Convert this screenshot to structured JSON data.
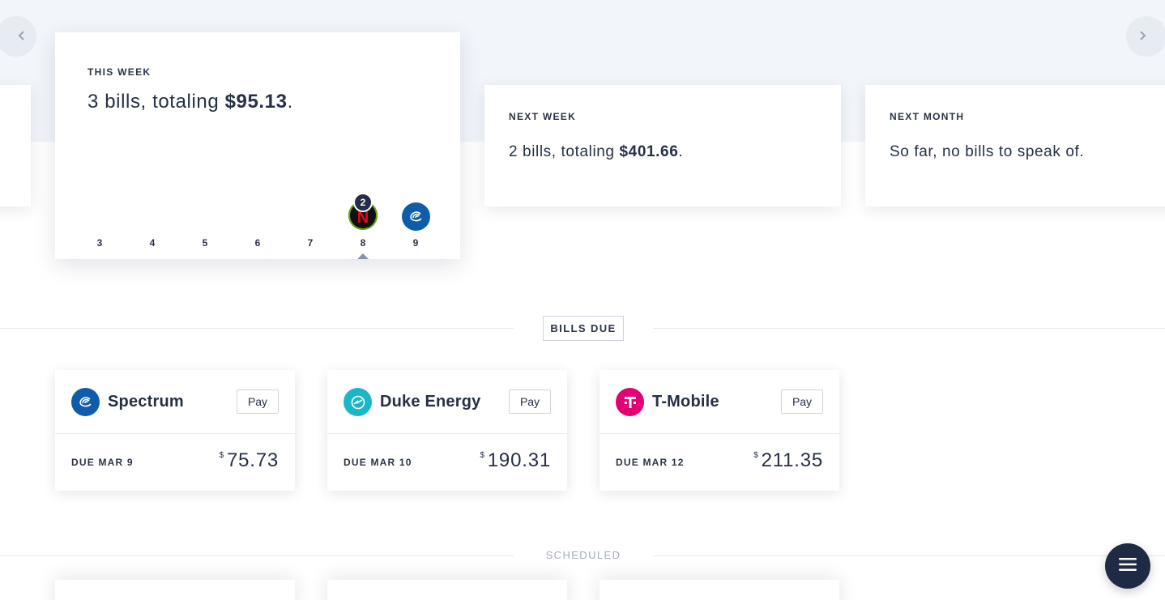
{
  "carousel": {
    "this_week": {
      "label": "THIS WEEK",
      "summary_prefix": "3 bills, totaling ",
      "summary_total": "$95.13",
      "summary_suffix": ".",
      "days": [
        "3",
        "4",
        "5",
        "6",
        "7",
        "8",
        "9"
      ],
      "selected_day": "8",
      "day8_bill_count": "2",
      "day8_icon": "netflix-logo-icon",
      "day9_icon": "spectrum-logo-icon"
    },
    "next_week": {
      "label": "NEXT WEEK",
      "summary_prefix": "2 bills, totaling ",
      "summary_total": "$401.66",
      "summary_suffix": "."
    },
    "next_month": {
      "label": "NEXT MONTH",
      "summary": "So far, no bills to speak of."
    }
  },
  "sections": {
    "bills_due": "BILLS DUE",
    "scheduled": "SCHEDULED"
  },
  "bills": [
    {
      "name": "Spectrum",
      "pay_label": "Pay",
      "due": "DUE MAR 9",
      "currency": "$",
      "amount": "75.73",
      "color": "#0d5dab",
      "icon": "spectrum-logo-icon"
    },
    {
      "name": "Duke Energy",
      "pay_label": "Pay",
      "due": "DUE MAR 10",
      "currency": "$",
      "amount": "190.31",
      "color": "#1bb7c9",
      "icon": "duke-energy-logo-icon"
    },
    {
      "name": "T-Mobile",
      "pay_label": "Pay",
      "due": "DUE MAR 12",
      "currency": "$",
      "amount": "211.35",
      "color": "#e20074",
      "icon": "t-mobile-logo-icon"
    }
  ],
  "colors": {
    "accent_dark": "#1f2b44",
    "background_band": "#f2f5fa"
  }
}
